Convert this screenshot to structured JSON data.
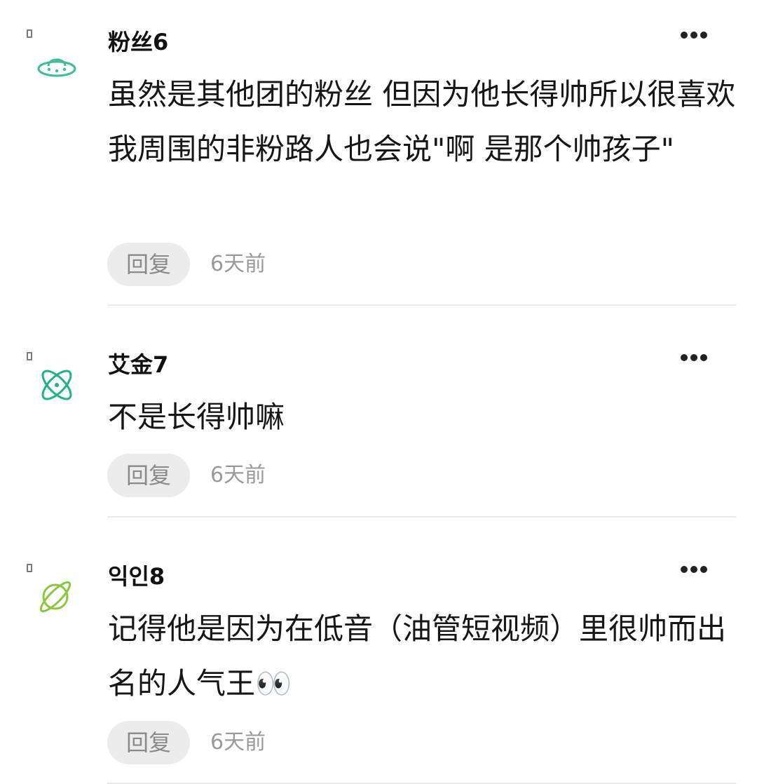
{
  "comments": [
    {
      "username": "粉丝6",
      "avatar_icon": "ufo-icon",
      "avatar_color": "#3fbf8f",
      "content": "虽然是其他团的粉丝 但因为他长得帅所以很喜欢 我周围的非粉路人也会说\"啊 是那个帅孩子\"",
      "reply_label": "回复",
      "time": "6天前"
    },
    {
      "username": "艾金7",
      "avatar_icon": "atom-icon",
      "avatar_color": "#1fb38a",
      "content": "不是长得帅嘛",
      "reply_label": "回复",
      "time": "6天前"
    },
    {
      "username": "익인8",
      "avatar_icon": "planet-icon",
      "avatar_color": "#8cc63e",
      "content": "记得他是因为在低音（油管短视频）里很帅而出名的人气王👀",
      "reply_label": "回复",
      "time": "6天前"
    }
  ]
}
